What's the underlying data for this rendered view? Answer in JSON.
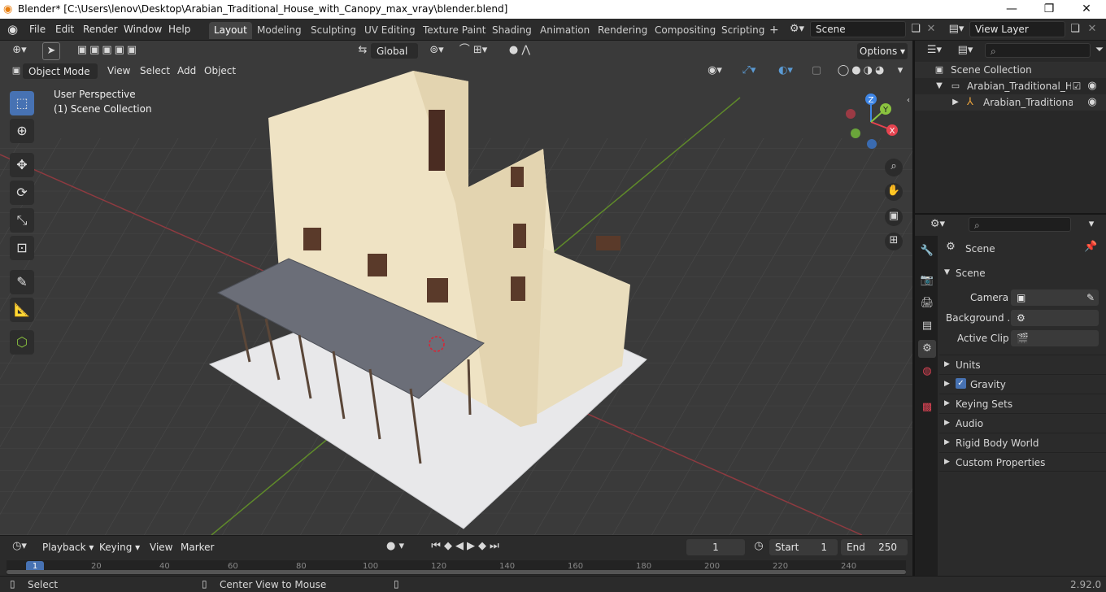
{
  "window": {
    "title": "Blender* [C:\\Users\\lenov\\Desktop\\Arabian_Traditional_House_with_Canopy_max_vray\\blender.blend]",
    "min_symbol": "—",
    "max_symbol": "❐",
    "close_symbol": "✕"
  },
  "menu": [
    "File",
    "Edit",
    "Render",
    "Window",
    "Help"
  ],
  "workspaces": [
    "Layout",
    "Modeling",
    "Sculpting",
    "UV Editing",
    "Texture Paint",
    "Shading",
    "Animation",
    "Rendering",
    "Compositing",
    "Scripting"
  ],
  "workspace_add": "+",
  "scene_field": "Scene",
  "view_layer_field": "View Layer",
  "viewport": {
    "mode": "Object Mode",
    "menus": [
      "View",
      "Select",
      "Add",
      "Object"
    ],
    "transform_orientation": "Global",
    "options_label": "Options",
    "overlay_title": "User Perspective",
    "overlay_subtitle": "(1) Scene Collection",
    "gizmo_axes": {
      "x": "X",
      "y": "Y",
      "z": "Z"
    },
    "axis_colors": {
      "x": "#e6434f",
      "y": "#8bc43f",
      "z": "#3f86e6"
    }
  },
  "outliner": {
    "root": "Scene Collection",
    "collection": "Arabian_Traditional_Hous",
    "object": "Arabian_Traditional_I"
  },
  "properties": {
    "header": "Scene",
    "panel": "Scene",
    "camera_label": "Camera",
    "background_label": "Background ...",
    "active_clip_label": "Active Clip",
    "sections": [
      "Units",
      "Gravity",
      "Keying Sets",
      "Audio",
      "Rigid Body World",
      "Custom Properties"
    ],
    "gravity_checked": true
  },
  "timeline": {
    "menus": [
      "Playback",
      "Keying",
      "View",
      "Marker"
    ],
    "current_frame": "1",
    "start_label": "Start",
    "start_value": "1",
    "end_label": "End",
    "end_value": "250",
    "ruler": [
      "1",
      "20",
      "40",
      "60",
      "80",
      "100",
      "120",
      "140",
      "160",
      "180",
      "200",
      "220",
      "240"
    ]
  },
  "status": {
    "select_label": "Select",
    "center_label": "Center View to Mouse",
    "version": "2.92.0"
  },
  "colors": {
    "accent": "#4772b3",
    "viewport_bg": "#3c3c3c"
  }
}
